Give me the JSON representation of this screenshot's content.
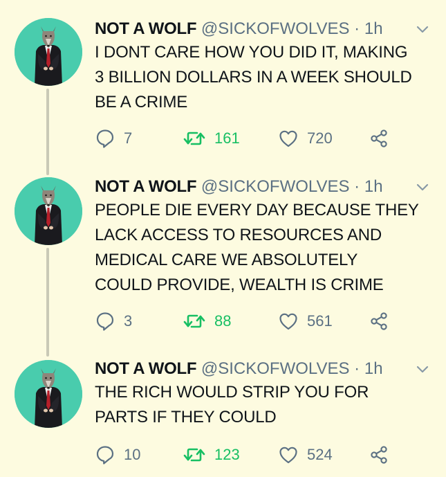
{
  "tweets": [
    {
      "name": "NOT A WOLF",
      "handle": "@SICKOFWOLVES",
      "separator": "·",
      "time": "1h",
      "text": "I DONT CARE HOW YOU DID IT, MAKING\n3 BILLION DOLLARS IN A WEEK SHOULD\nBE A CRIME",
      "replies": "7",
      "retweets": "161",
      "likes": "720"
    },
    {
      "name": "NOT A WOLF",
      "handle": "@SICKOFWOLVES",
      "separator": "·",
      "time": "1h",
      "text": "PEOPLE DIE EVERY DAY BECAUSE THEY\nLACK ACCESS TO RESOURCES AND\nMEDICAL CARE WE ABSOLUTELY\nCOULD PROVIDE, WEALTH IS CRIME",
      "replies": "3",
      "retweets": "88",
      "likes": "561"
    },
    {
      "name": "NOT A WOLF",
      "handle": "@SICKOFWOLVES",
      "separator": "·",
      "time": "1h",
      "text": "THE RICH WOULD STRIP YOU FOR\nPARTS IF THEY COULD",
      "replies": "10",
      "retweets": "123",
      "likes": "524"
    }
  ],
  "icons": {
    "reply": "reply-icon",
    "retweet": "retweet-icon",
    "like": "heart-icon",
    "share": "share-icon",
    "caret": "chevron-down-icon"
  },
  "colors": {
    "background": "#fdfbe0",
    "avatar": "#49ccad",
    "retweet_count": "#17bf63",
    "muted": "#5b7083",
    "thread_line": "#c9c9b6"
  }
}
